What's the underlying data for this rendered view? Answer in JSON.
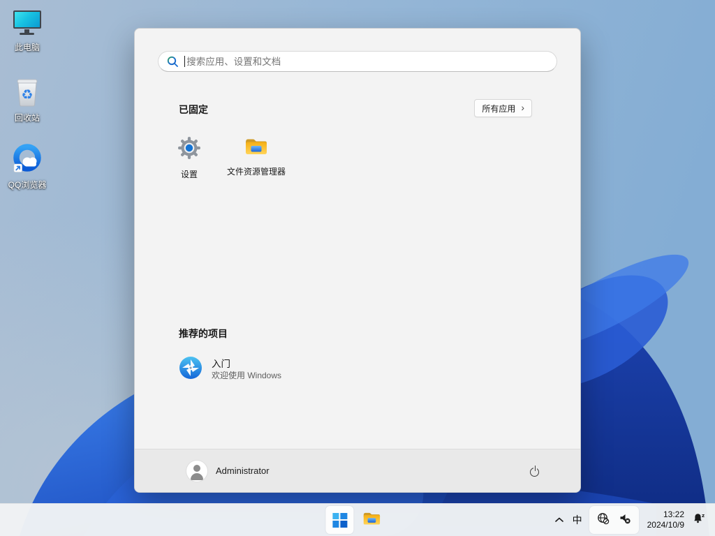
{
  "desktop": {
    "icons": [
      {
        "label": "此电脑",
        "icon": "this-pc-icon"
      },
      {
        "label": "回收站",
        "icon": "recycle-bin-icon"
      },
      {
        "label": "QQ浏览器",
        "icon": "qq-browser-icon"
      }
    ]
  },
  "start_menu": {
    "search": {
      "placeholder": "搜索应用、设置和文档",
      "icon": "search-icon"
    },
    "pinned": {
      "heading": "已固定",
      "all_apps_label": "所有应用",
      "all_apps_chevron": "›",
      "apps": [
        {
          "label": "设置",
          "icon": "settings-gear-icon"
        },
        {
          "label": "文件资源管理器",
          "icon": "file-explorer-icon"
        }
      ]
    },
    "recommended": {
      "heading": "推荐的项目",
      "items": [
        {
          "title": "入门",
          "subtitle": "欢迎使用 Windows",
          "icon": "get-started-icon"
        }
      ]
    },
    "footer": {
      "user_name": "Administrator"
    }
  },
  "taskbar": {
    "ime_indicator": "中",
    "clock": {
      "time": "13:22",
      "date": "2024/10/9"
    }
  },
  "icons": {
    "search-icon": "magnifier",
    "this-pc-icon": "teal monitor",
    "recycle-bin-icon": "bin with recycle arrows",
    "qq-browser-icon": "blue ring with cloud + shortcut arrow",
    "settings-gear-icon": "gray gear, blue hub",
    "file-explorer-icon": "yellow folder with blue file",
    "get-started-icon": "blue circle white pinwheel",
    "user-avatar": "person silhouette",
    "power-icon": "power symbol",
    "start-windows-icon": "four blue squares",
    "chevron-up-icon": "^",
    "globe-offline-icon": "globe with no-internet badge",
    "volume-muted-icon": "speaker with x badge",
    "bell-dnd-icon": "notification bell with z"
  },
  "colors": {
    "accent_blue": "#0d60ca",
    "bloom_blue": "#2a6ae0",
    "bloom_navy": "#12318e",
    "menu_bg": "#f3f3f3",
    "taskbar_bg": "#f1f3f4"
  }
}
